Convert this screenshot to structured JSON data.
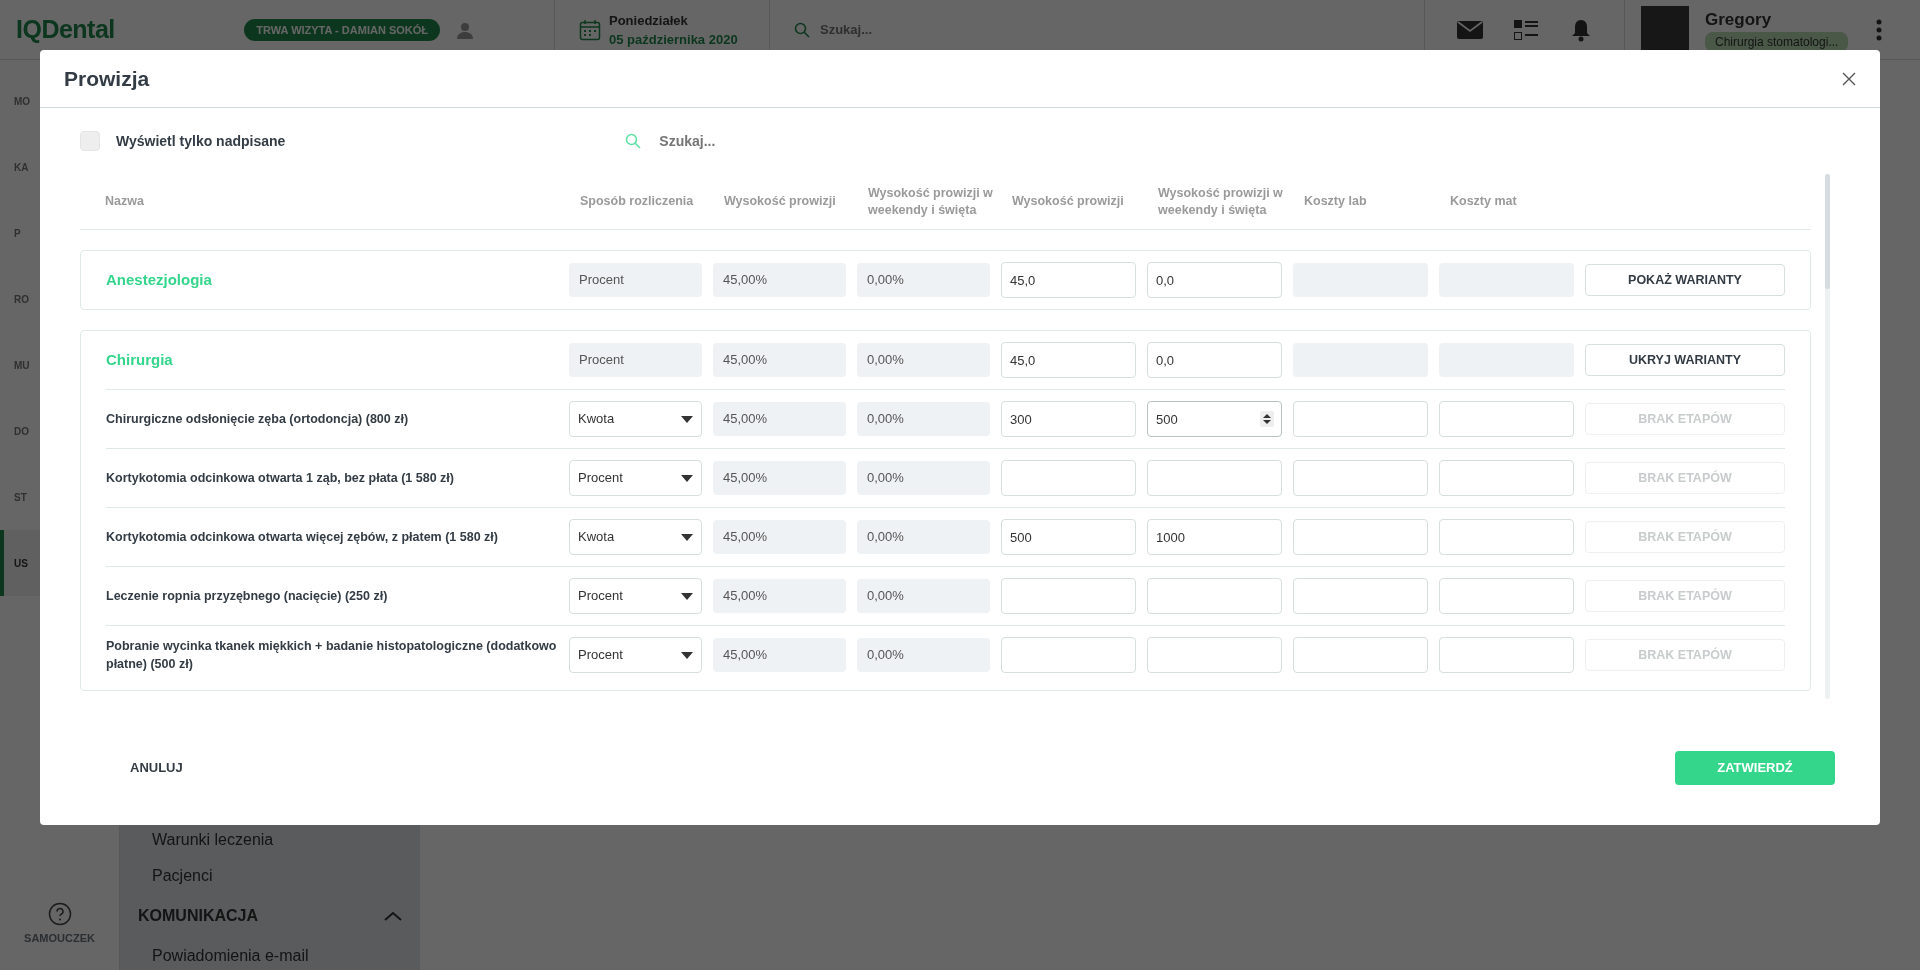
{
  "app": {
    "logo": "IQDental",
    "visit_badge": "TRWA WIZYTA - DAMIAN SOKÓŁ",
    "day": "Poniedziałek",
    "date": "05 października 2020",
    "search": {
      "placeholder": "Szukaj..."
    },
    "user": {
      "name": "Gregory",
      "role": "Chirurgia stomatologi..."
    }
  },
  "sidebar": {
    "items": [
      {
        "label": "MO",
        "selected": false
      },
      {
        "label": "KA",
        "selected": false
      },
      {
        "label": "P",
        "selected": false
      },
      {
        "label": "RO",
        "selected": false
      },
      {
        "label": "MU",
        "selected": false
      },
      {
        "label": "DO",
        "selected": false
      },
      {
        "label": "ST",
        "selected": false
      },
      {
        "label": "US",
        "selected": true
      }
    ],
    "help": "SAMOUCZEK"
  },
  "submenu": {
    "items": [
      "Warunki leczenia",
      "Pacjenci"
    ],
    "section": {
      "label": "KOMUNIKACJA",
      "expanded": true,
      "items": [
        "Powiadomienia e-mail"
      ]
    }
  },
  "modal": {
    "title": "Prowizja",
    "filter": {
      "label": "Wyświetl tylko nadpisane",
      "checked": false
    },
    "search": {
      "placeholder": "Szukaj..."
    },
    "columns": [
      "Nazwa",
      "Sposób rozliczenia",
      "Wysokość prowizji",
      "Wysokość prowizji w weekendy i święta",
      "Wysokość prowizji",
      "Wysokość prowizji w weekendy i święta",
      "Koszty lab",
      "Koszty mat"
    ],
    "groups": [
      {
        "name": "Anestezjologia",
        "billing": "Procent",
        "commission": "45,00%",
        "weekend": "0,00%",
        "value": "45,0",
        "weekend_value": "0,0",
        "toggle": "POKAŻ WARIANTY",
        "expanded": false
      },
      {
        "name": "Chirurgia",
        "billing": "Procent",
        "commission": "45,00%",
        "weekend": "0,00%",
        "value": "45,0",
        "weekend_value": "0,0",
        "toggle": "UKRYJ WARIANTY",
        "expanded": true,
        "variants": [
          {
            "name": "Chirurgiczne odsłonięcie zęba (ortodoncja) (800 zł)",
            "billing": "Kwota",
            "commission": "45,00%",
            "weekend": "0,00%",
            "value": "300",
            "weekend_value": "500",
            "editing": true,
            "action": "BRAK ETAPÓW",
            "disabled": true
          },
          {
            "name": "Kortykotomia odcinkowa otwarta 1 ząb, bez płata (1 580 zł)",
            "billing": "Procent",
            "commission": "45,00%",
            "weekend": "0,00%",
            "editing": false,
            "action": "BRAK ETAPÓW",
            "disabled": true
          },
          {
            "name": "Kortykotomia odcinkowa otwarta więcej zębów, z płatem (1 580 zł)",
            "billing": "Kwota",
            "commission": "45,00%",
            "weekend": "0,00%",
            "value": "500",
            "weekend_value": "1000",
            "editing": false,
            "action": "BRAK ETAPÓW",
            "disabled": true
          },
          {
            "name": "Leczenie ropnia przyzębnego (nacięcie) (250 zł)",
            "billing": "Procent",
            "commission": "45,00%",
            "weekend": "0,00%",
            "editing": false,
            "action": "BRAK ETAPÓW",
            "disabled": true
          },
          {
            "name": "Pobranie wycinka tkanek miękkich + badanie histopatologiczne (dodatkowo płatne) (500 zł)",
            "billing": "Procent",
            "commission": "45,00%",
            "weekend": "0,00%",
            "editing": false,
            "action": "BRAK ETAPÓW",
            "disabled": true
          }
        ]
      }
    ],
    "cancel": "ANULUJ",
    "confirm": "ZATWIERDŹ"
  }
}
